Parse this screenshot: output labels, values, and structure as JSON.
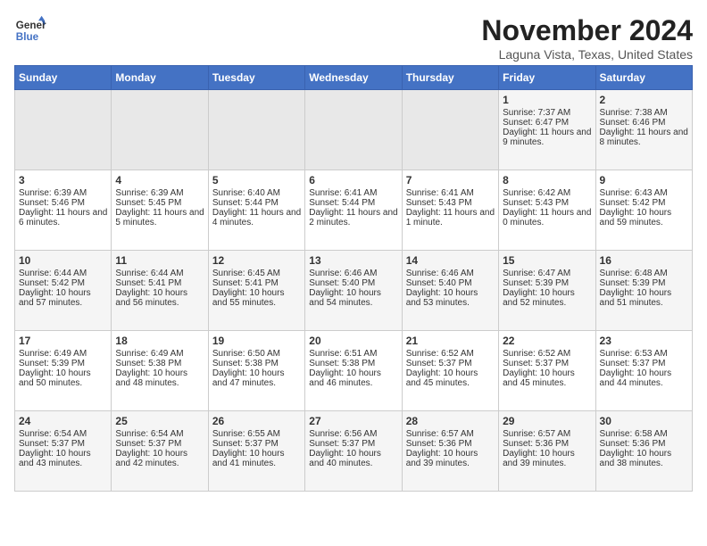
{
  "header": {
    "logo_line1": "General",
    "logo_line2": "Blue",
    "month": "November 2024",
    "location": "Laguna Vista, Texas, United States"
  },
  "weekdays": [
    "Sunday",
    "Monday",
    "Tuesday",
    "Wednesday",
    "Thursday",
    "Friday",
    "Saturday"
  ],
  "weeks": [
    [
      {
        "day": "",
        "sunrise": "",
        "sunset": "",
        "daylight": ""
      },
      {
        "day": "",
        "sunrise": "",
        "sunset": "",
        "daylight": ""
      },
      {
        "day": "",
        "sunrise": "",
        "sunset": "",
        "daylight": ""
      },
      {
        "day": "",
        "sunrise": "",
        "sunset": "",
        "daylight": ""
      },
      {
        "day": "",
        "sunrise": "",
        "sunset": "",
        "daylight": ""
      },
      {
        "day": "1",
        "sunrise": "Sunrise: 7:37 AM",
        "sunset": "Sunset: 6:47 PM",
        "daylight": "Daylight: 11 hours and 9 minutes."
      },
      {
        "day": "2",
        "sunrise": "Sunrise: 7:38 AM",
        "sunset": "Sunset: 6:46 PM",
        "daylight": "Daylight: 11 hours and 8 minutes."
      }
    ],
    [
      {
        "day": "3",
        "sunrise": "Sunrise: 6:39 AM",
        "sunset": "Sunset: 5:46 PM",
        "daylight": "Daylight: 11 hours and 6 minutes."
      },
      {
        "day": "4",
        "sunrise": "Sunrise: 6:39 AM",
        "sunset": "Sunset: 5:45 PM",
        "daylight": "Daylight: 11 hours and 5 minutes."
      },
      {
        "day": "5",
        "sunrise": "Sunrise: 6:40 AM",
        "sunset": "Sunset: 5:44 PM",
        "daylight": "Daylight: 11 hours and 4 minutes."
      },
      {
        "day": "6",
        "sunrise": "Sunrise: 6:41 AM",
        "sunset": "Sunset: 5:44 PM",
        "daylight": "Daylight: 11 hours and 2 minutes."
      },
      {
        "day": "7",
        "sunrise": "Sunrise: 6:41 AM",
        "sunset": "Sunset: 5:43 PM",
        "daylight": "Daylight: 11 hours and 1 minute."
      },
      {
        "day": "8",
        "sunrise": "Sunrise: 6:42 AM",
        "sunset": "Sunset: 5:43 PM",
        "daylight": "Daylight: 11 hours and 0 minutes."
      },
      {
        "day": "9",
        "sunrise": "Sunrise: 6:43 AM",
        "sunset": "Sunset: 5:42 PM",
        "daylight": "Daylight: 10 hours and 59 minutes."
      }
    ],
    [
      {
        "day": "10",
        "sunrise": "Sunrise: 6:44 AM",
        "sunset": "Sunset: 5:42 PM",
        "daylight": "Daylight: 10 hours and 57 minutes."
      },
      {
        "day": "11",
        "sunrise": "Sunrise: 6:44 AM",
        "sunset": "Sunset: 5:41 PM",
        "daylight": "Daylight: 10 hours and 56 minutes."
      },
      {
        "day": "12",
        "sunrise": "Sunrise: 6:45 AM",
        "sunset": "Sunset: 5:41 PM",
        "daylight": "Daylight: 10 hours and 55 minutes."
      },
      {
        "day": "13",
        "sunrise": "Sunrise: 6:46 AM",
        "sunset": "Sunset: 5:40 PM",
        "daylight": "Daylight: 10 hours and 54 minutes."
      },
      {
        "day": "14",
        "sunrise": "Sunrise: 6:46 AM",
        "sunset": "Sunset: 5:40 PM",
        "daylight": "Daylight: 10 hours and 53 minutes."
      },
      {
        "day": "15",
        "sunrise": "Sunrise: 6:47 AM",
        "sunset": "Sunset: 5:39 PM",
        "daylight": "Daylight: 10 hours and 52 minutes."
      },
      {
        "day": "16",
        "sunrise": "Sunrise: 6:48 AM",
        "sunset": "Sunset: 5:39 PM",
        "daylight": "Daylight: 10 hours and 51 minutes."
      }
    ],
    [
      {
        "day": "17",
        "sunrise": "Sunrise: 6:49 AM",
        "sunset": "Sunset: 5:39 PM",
        "daylight": "Daylight: 10 hours and 50 minutes."
      },
      {
        "day": "18",
        "sunrise": "Sunrise: 6:49 AM",
        "sunset": "Sunset: 5:38 PM",
        "daylight": "Daylight: 10 hours and 48 minutes."
      },
      {
        "day": "19",
        "sunrise": "Sunrise: 6:50 AM",
        "sunset": "Sunset: 5:38 PM",
        "daylight": "Daylight: 10 hours and 47 minutes."
      },
      {
        "day": "20",
        "sunrise": "Sunrise: 6:51 AM",
        "sunset": "Sunset: 5:38 PM",
        "daylight": "Daylight: 10 hours and 46 minutes."
      },
      {
        "day": "21",
        "sunrise": "Sunrise: 6:52 AM",
        "sunset": "Sunset: 5:37 PM",
        "daylight": "Daylight: 10 hours and 45 minutes."
      },
      {
        "day": "22",
        "sunrise": "Sunrise: 6:52 AM",
        "sunset": "Sunset: 5:37 PM",
        "daylight": "Daylight: 10 hours and 45 minutes."
      },
      {
        "day": "23",
        "sunrise": "Sunrise: 6:53 AM",
        "sunset": "Sunset: 5:37 PM",
        "daylight": "Daylight: 10 hours and 44 minutes."
      }
    ],
    [
      {
        "day": "24",
        "sunrise": "Sunrise: 6:54 AM",
        "sunset": "Sunset: 5:37 PM",
        "daylight": "Daylight: 10 hours and 43 minutes."
      },
      {
        "day": "25",
        "sunrise": "Sunrise: 6:54 AM",
        "sunset": "Sunset: 5:37 PM",
        "daylight": "Daylight: 10 hours and 42 minutes."
      },
      {
        "day": "26",
        "sunrise": "Sunrise: 6:55 AM",
        "sunset": "Sunset: 5:37 PM",
        "daylight": "Daylight: 10 hours and 41 minutes."
      },
      {
        "day": "27",
        "sunrise": "Sunrise: 6:56 AM",
        "sunset": "Sunset: 5:37 PM",
        "daylight": "Daylight: 10 hours and 40 minutes."
      },
      {
        "day": "28",
        "sunrise": "Sunrise: 6:57 AM",
        "sunset": "Sunset: 5:36 PM",
        "daylight": "Daylight: 10 hours and 39 minutes."
      },
      {
        "day": "29",
        "sunrise": "Sunrise: 6:57 AM",
        "sunset": "Sunset: 5:36 PM",
        "daylight": "Daylight: 10 hours and 39 minutes."
      },
      {
        "day": "30",
        "sunrise": "Sunrise: 6:58 AM",
        "sunset": "Sunset: 5:36 PM",
        "daylight": "Daylight: 10 hours and 38 minutes."
      }
    ]
  ]
}
